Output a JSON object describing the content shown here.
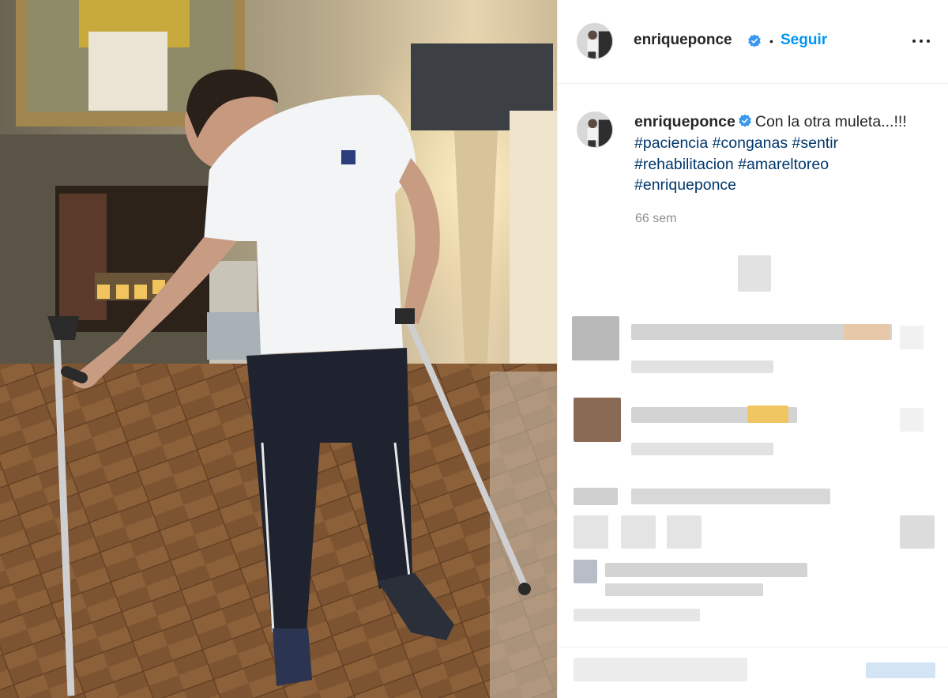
{
  "post": {
    "username": "enriqueponce",
    "follow_label": "Seguir",
    "separator": "•",
    "caption_text": "Con la otra muleta...!!!",
    "hashtags": [
      "#paciencia",
      "#conganas",
      "#sentir",
      "#rehabilitacion",
      "#amareltoreo",
      "#enriqueponce"
    ],
    "time_ago": "66 sem"
  },
  "icons": {
    "verified": "verified-badge-icon",
    "more": "more-options-icon"
  },
  "colors": {
    "link_blue": "#0095f6",
    "hashtag_blue": "#00376b",
    "muted_gray": "#8e8e8e",
    "text": "#262626",
    "border": "#efefef"
  }
}
